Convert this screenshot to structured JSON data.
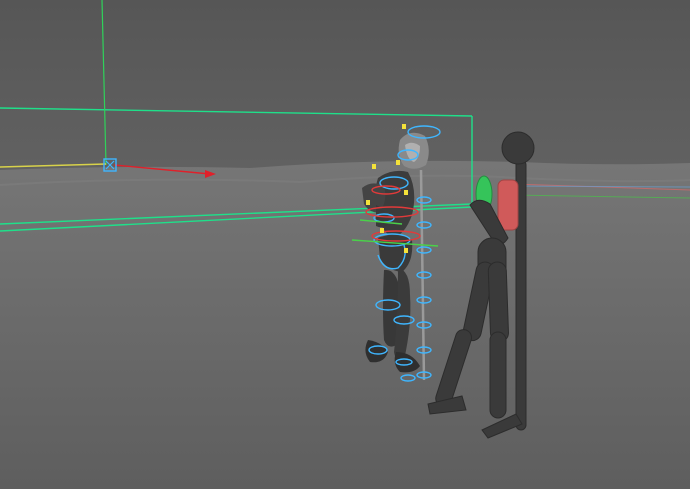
{
  "viewport": {
    "background_color": "#5a5a5a",
    "ground_color": "#6f6f6f",
    "horizon_color": "#7a7a7a",
    "selection_box_color": "#1fe08a",
    "camera_axis_vertical_color": "#2fd25a",
    "camera_axis_x_color": "#e0202a",
    "camera_axis_z_color": "#d8d24a",
    "rig_control_color": "#3fb6ff",
    "rig_red_control_color": "#e23a3a",
    "rig_green_control_color": "#4ad14a",
    "rig_yellow_marker_color": "#f4e23a",
    "character_mesh_color": "#3c3c3c",
    "mannequin_color": "#3a3a3a",
    "mannequin_green_part_color": "#35c45a",
    "mannequin_red_part_color": "#d05a5a",
    "icons": [
      "locator-icon"
    ]
  }
}
